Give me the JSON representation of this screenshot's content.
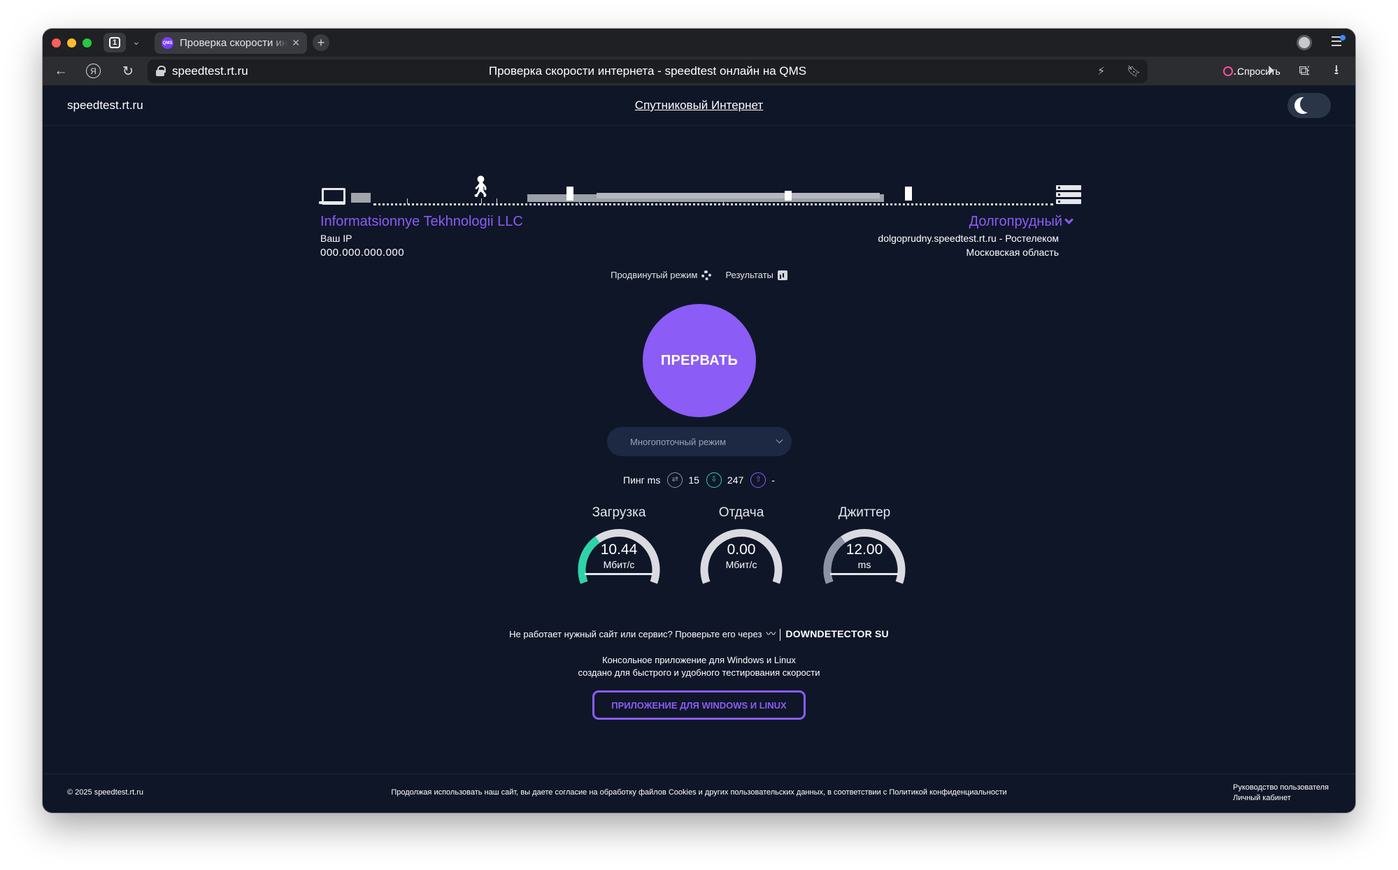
{
  "browser": {
    "tab_count": "1",
    "tab_title": "Проверка скорости интернета",
    "favicon_text": "QMS",
    "domain": "speedtest.rt.ru",
    "page_title": "Проверка скорости интернета - speedtest онлайн на QMS",
    "ask_label": "Спросить",
    "more_label": "..."
  },
  "header": {
    "logo": "speedtest.rt.ru",
    "satellite_link": "Спутниковый Интернет"
  },
  "client": {
    "isp": "Informatsionnye Tekhnologii LLC",
    "ip_label": "Ваш IP",
    "ip": "000.000.000.000"
  },
  "server": {
    "city": "Долгопрудный",
    "host": "dolgoprudny.speedtest.rt.ru - Ростелеком",
    "region": "Московская область"
  },
  "controls": {
    "advanced_mode": "Продвинутый режим",
    "results": "Результаты",
    "stop_button": "ПРЕРВАТЬ",
    "thread_mode": "Многопоточный режим"
  },
  "ping": {
    "label": "Пинг ms",
    "ping": "15",
    "download_ping": "247",
    "upload_ping": "-"
  },
  "gauges": {
    "download": {
      "label": "Загрузка",
      "value": "10.44",
      "unit": "Мбит/с",
      "fill": 0.34,
      "color": "#2dd4a8"
    },
    "upload": {
      "label": "Отдача",
      "value": "0.00",
      "unit": "Мбит/с",
      "fill": 0,
      "color": "#8b5cf6"
    },
    "jitter": {
      "label": "Джиттер",
      "value": "12.00",
      "unit": "ms",
      "fill": 0.34,
      "color": "#8c93a5"
    }
  },
  "downdetector": {
    "text": "Не работает нужный сайт или сервис? Проверьте его через",
    "brand": "DOWNDETECTOR SU"
  },
  "console_app": {
    "line1": "Консольное приложение для Windows и Linux",
    "line2": "создано для быстрого и удобного тестирования скорости",
    "button": "ПРИЛОЖЕНИЕ ДЛЯ WINDOWS И LINUX"
  },
  "footer": {
    "copyright": "© 2025 speedtest.rt.ru",
    "cookies": "Продолжая использовать наш сайт, вы даете согласие на обработку файлов Cookies и других пользовательских данных, в соответствии с Политикой конфиденциальности",
    "guide": "Руководство пользователя",
    "cabinet": "Личный кабинет"
  },
  "colors": {
    "accent": "#8b5cf6",
    "background": "#0f1628",
    "download": "#2dd4a8"
  }
}
